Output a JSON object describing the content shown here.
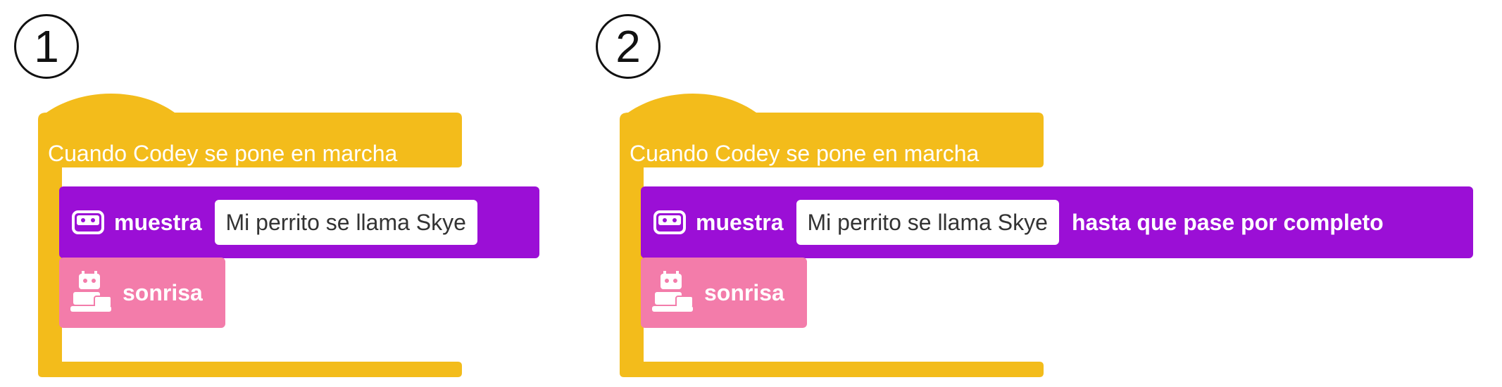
{
  "panels": [
    {
      "number": "1",
      "hat_label": "Cuando Codey se pone en marcha",
      "show_block": {
        "label": "muestra",
        "text_value": "Mi perrito se llama Skye",
        "suffix": ""
      },
      "smile_block": {
        "label": "sonrisa"
      }
    },
    {
      "number": "2",
      "hat_label": "Cuando Codey se pone en marcha",
      "show_block": {
        "label": "muestra",
        "text_value": "Mi perrito se llama Skye",
        "suffix": "hasta que pase por completo"
      },
      "smile_block": {
        "label": "sonrisa"
      }
    }
  ],
  "colors": {
    "event_block": "#f3bc1b",
    "display_block": "#9b0fd6",
    "emotion_block": "#f37caa"
  },
  "icons": [
    "codey-face-icon",
    "codey-robot-icon"
  ]
}
